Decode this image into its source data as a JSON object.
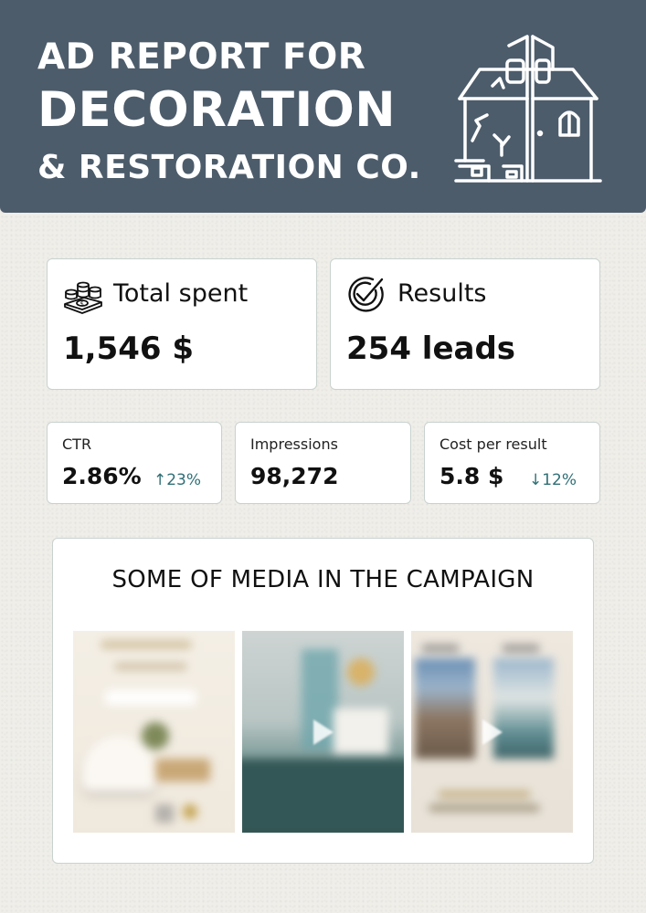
{
  "header": {
    "line1": "AD REPORT FOR",
    "line2": "DECORATION",
    "line3": "& RESTORATION CO.",
    "icon": "house-renovation-icon",
    "bg_color": "#4d5c6b"
  },
  "stats": {
    "total_spent": {
      "label": "Total spent",
      "value": "1,546 $",
      "icon": "money-coins-icon"
    },
    "results": {
      "label": "Results",
      "value": "254 leads",
      "icon": "target-check-icon"
    },
    "ctr": {
      "label": "CTR",
      "value": "2.86%",
      "delta": "↑23%"
    },
    "impressions": {
      "label": "Impressions",
      "value": "98,272"
    },
    "cost_per_result": {
      "label": "Cost per result",
      "value": "5.8 $",
      "delta": "↓12%"
    }
  },
  "media": {
    "title": "SOME OF MEDIA IN THE CAMPAIGN",
    "thumbnails": [
      "media-thumbnail-1",
      "media-thumbnail-2",
      "media-thumbnail-3"
    ]
  },
  "colors": {
    "accent": "#2f6f76",
    "card_border": "#c9d2d0",
    "page_bg": "#efeee9"
  }
}
